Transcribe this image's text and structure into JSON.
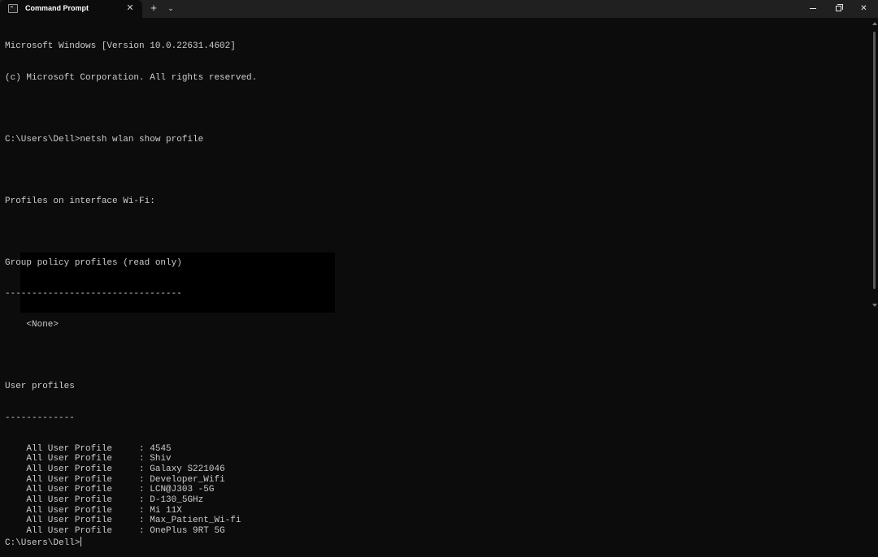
{
  "window": {
    "tab_title": "Command Prompt",
    "tab_icon": "terminal-icon",
    "close_tab_symbol": "✕",
    "new_tab_symbol": "+",
    "dropdown_symbol": "⌄",
    "close_window_symbol": "✕"
  },
  "terminal": {
    "version_line": "Microsoft Windows [Version 10.0.22631.4602]",
    "copyright_line": "(c) Microsoft Corporation. All rights reserved.",
    "command_line": "C:\\Users\\Dell>netsh wlan show profile",
    "profiles_header": "Profiles on interface Wi-Fi:",
    "group_policy_header": "Group policy profiles (read only)",
    "group_policy_rule": "---------------------------------",
    "group_policy_none": "    <None>",
    "user_profiles_header": "User profiles",
    "user_profiles_rule": "-------------",
    "profile_label": "All User Profile",
    "profiles": [
      "4545",
      "Shiv",
      "Galaxy S221046",
      "Developer_Wifi",
      "LCN@J303 -5G",
      "D-130_5GHz",
      "Mi 11X",
      "Max_Patient_Wi-fi",
      "OnePlus 9RT 5G"
    ],
    "prompt": "C:\\Users\\Dell>"
  },
  "colors": {
    "background": "#0c0c0c",
    "titlebar": "#202020",
    "text": "#cccccc"
  }
}
